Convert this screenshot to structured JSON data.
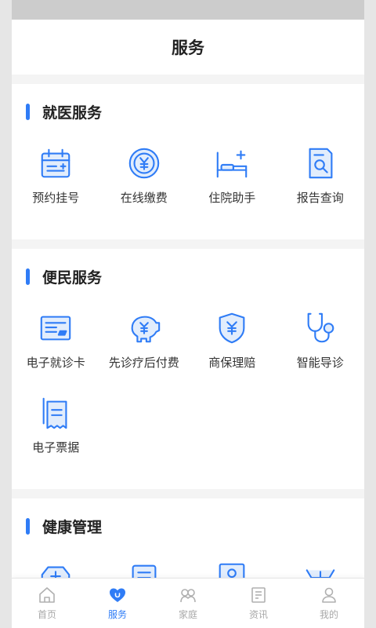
{
  "header": {
    "title": "服务"
  },
  "sections": [
    {
      "title": "就医服务",
      "items": [
        {
          "label": "预约挂号",
          "icon": "calendar-icon"
        },
        {
          "label": "在线缴费",
          "icon": "yuan-coin-icon"
        },
        {
          "label": "住院助手",
          "icon": "hospital-bed-icon"
        },
        {
          "label": "报告查询",
          "icon": "report-search-icon"
        }
      ]
    },
    {
      "title": "便民服务",
      "items": [
        {
          "label": "电子就诊卡",
          "icon": "card-icon"
        },
        {
          "label": "先诊疗后付费",
          "icon": "piggy-bank-icon"
        },
        {
          "label": "商保理赔",
          "icon": "shield-yuan-icon"
        },
        {
          "label": "智能导诊",
          "icon": "stethoscope-icon"
        },
        {
          "label": "电子票据",
          "icon": "receipt-icon"
        }
      ]
    },
    {
      "title": "健康管理",
      "items": [
        {
          "icon": "medkit-icon"
        },
        {
          "icon": "document-icon"
        },
        {
          "icon": "profile-card-icon"
        },
        {
          "icon": "crib-icon"
        }
      ]
    }
  ],
  "tabbar": [
    {
      "label": "首页",
      "icon": "home-icon",
      "active": false
    },
    {
      "label": "服务",
      "icon": "heart-icon",
      "active": true
    },
    {
      "label": "家庭",
      "icon": "family-icon",
      "active": false
    },
    {
      "label": "资讯",
      "icon": "news-icon",
      "active": false
    },
    {
      "label": "我的",
      "icon": "user-icon",
      "active": false
    }
  ],
  "colors": {
    "accent": "#2f7cf6",
    "accent_light": "#e2edfc",
    "inactive": "#a8a8a8"
  }
}
